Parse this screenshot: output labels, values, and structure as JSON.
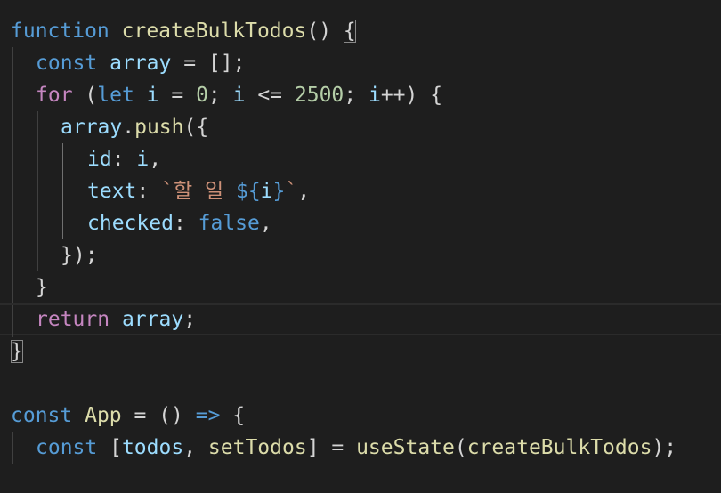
{
  "editor": {
    "colors": {
      "background": "#1e1e1e",
      "keyword": "#569cd6",
      "control": "#c586c0",
      "function": "#dcdcaa",
      "variable": "#9cdcfe",
      "number": "#b5cea8",
      "string": "#ce9178",
      "punctuation": "#d4d4d4"
    },
    "lines": [
      [
        [
          "kw",
          "function"
        ],
        [
          "p",
          " "
        ],
        [
          "fn",
          "createBulkTodos"
        ],
        [
          "p",
          "() "
        ],
        [
          "p",
          "{"
        ]
      ],
      [
        [
          "kw",
          "const"
        ],
        [
          "p",
          " "
        ],
        [
          "var",
          "array"
        ],
        [
          "p",
          " = [];"
        ]
      ],
      [
        [
          "ctl",
          "for"
        ],
        [
          "p",
          " ("
        ],
        [
          "kw",
          "let"
        ],
        [
          "p",
          " "
        ],
        [
          "var",
          "i"
        ],
        [
          "p",
          " = "
        ],
        [
          "num",
          "0"
        ],
        [
          "p",
          "; "
        ],
        [
          "var",
          "i"
        ],
        [
          "p",
          " <= "
        ],
        [
          "num",
          "2500"
        ],
        [
          "p",
          "; "
        ],
        [
          "var",
          "i"
        ],
        [
          "p",
          "++) {"
        ]
      ],
      [
        [
          "var",
          "array"
        ],
        [
          "p",
          "."
        ],
        [
          "fn",
          "push"
        ],
        [
          "p",
          "({"
        ]
      ],
      [
        [
          "var",
          "id"
        ],
        [
          "p",
          ": "
        ],
        [
          "var",
          "i"
        ],
        [
          "p",
          ","
        ]
      ],
      [
        [
          "var",
          "text"
        ],
        [
          "p",
          ": "
        ],
        [
          "str",
          "`할 일 "
        ],
        [
          "kw",
          "${"
        ],
        [
          "var",
          "i"
        ],
        [
          "kw",
          "}"
        ],
        [
          "str",
          "`"
        ],
        [
          "p",
          ","
        ]
      ],
      [
        [
          "var",
          "checked"
        ],
        [
          "p",
          ": "
        ],
        [
          "kw",
          "false"
        ],
        [
          "p",
          ","
        ]
      ],
      [
        [
          "p",
          "});"
        ]
      ],
      [
        [
          "p",
          "}"
        ]
      ],
      [
        [
          "ctl",
          "return"
        ],
        [
          "p",
          " "
        ],
        [
          "var",
          "array"
        ],
        [
          "p",
          ";"
        ]
      ],
      [
        [
          "p",
          "}"
        ]
      ],
      [],
      [
        [
          "kw",
          "const"
        ],
        [
          "p",
          " "
        ],
        [
          "fn",
          "App"
        ],
        [
          "p",
          " = () "
        ],
        [
          "kw",
          "=>"
        ],
        [
          "p",
          " {"
        ]
      ],
      [
        [
          "kw",
          "const"
        ],
        [
          "p",
          " ["
        ],
        [
          "var",
          "todos"
        ],
        [
          "p",
          ", "
        ],
        [
          "fn",
          "setTodos"
        ],
        [
          "p",
          "] = "
        ],
        [
          "fn",
          "useState"
        ],
        [
          "p",
          "("
        ],
        [
          "fn",
          "createBulkTodos"
        ],
        [
          "p",
          ");"
        ]
      ]
    ]
  }
}
